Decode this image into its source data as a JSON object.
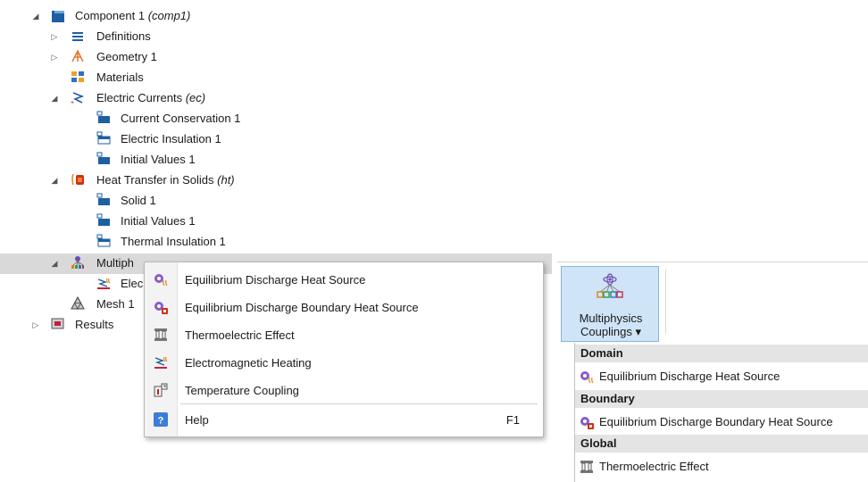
{
  "tree": {
    "component": {
      "label": "Component 1",
      "tag": "(comp1)"
    },
    "definitions": "Definitions",
    "geometry": "Geometry 1",
    "materials": "Materials",
    "ec": {
      "label": "Electric Currents",
      "tag": "(ec)"
    },
    "ec_children": [
      "Current Conservation 1",
      "Electric Insulation 1",
      "Initial Values 1"
    ],
    "ht": {
      "label": "Heat Transfer in Solids",
      "tag": "(ht)"
    },
    "ht_children": [
      "Solid 1",
      "Initial Values 1",
      "Thermal Insulation 1"
    ],
    "multiphysics": "Multiph",
    "mp_child": "Elec",
    "mesh": "Mesh 1",
    "results": "Results"
  },
  "context_menu": {
    "items": [
      {
        "label": "Equilibrium Discharge Heat Source",
        "icon": "discharge-heat-source-icon"
      },
      {
        "label": "Equilibrium Discharge Boundary Heat Source",
        "icon": "discharge-boundary-heat-source-icon"
      },
      {
        "label": "Thermoelectric Effect",
        "icon": "thermoelectric-icon"
      },
      {
        "label": "Electromagnetic Heating",
        "icon": "electromagnetic-heating-icon"
      },
      {
        "label": "Temperature Coupling",
        "icon": "temperature-coupling-icon"
      }
    ],
    "help": {
      "label": "Help",
      "shortcut": "F1",
      "icon": "help-icon"
    }
  },
  "ribbon": {
    "button_line1": "Multiphysics",
    "button_line2": "Couplings ▾",
    "dropdown": {
      "sections": [
        {
          "header": "Domain",
          "item": "Equilibrium Discharge Heat Source"
        },
        {
          "header": "Boundary",
          "item": "Equilibrium Discharge Boundary Heat Source"
        },
        {
          "header": "Global",
          "item": "Thermoelectric Effect"
        }
      ]
    }
  },
  "colors": {
    "selection": "#d9d9d9",
    "ribbon_button": "#cfe4f6",
    "section_header": "#e4e4e4",
    "accent_blue": "#1f5fa8"
  }
}
